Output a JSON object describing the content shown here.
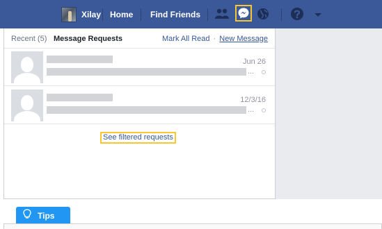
{
  "topbar": {
    "user_name": "Xilay",
    "home_label": "Home",
    "find_friends_label": "Find Friends",
    "icons": [
      "friends-icon",
      "messenger-icon",
      "globe-icon",
      "help-icon",
      "chevron-down-icon"
    ],
    "bg_color": "#3b5998",
    "highlight_color": "#f7c631"
  },
  "dropdown": {
    "tab_recent": "Recent (5)",
    "tab_requests": "Message Requests",
    "mark_all_read": "Mark All Read",
    "separator": "·",
    "new_message": "New Message",
    "requests": [
      {
        "date": "Jun 26",
        "ellipsis": "..."
      },
      {
        "date": "12/3/16",
        "ellipsis": "..."
      }
    ],
    "see_filtered": "See filtered requests"
  },
  "tips": {
    "label": "Tips",
    "accent_color": "#2196f3"
  }
}
